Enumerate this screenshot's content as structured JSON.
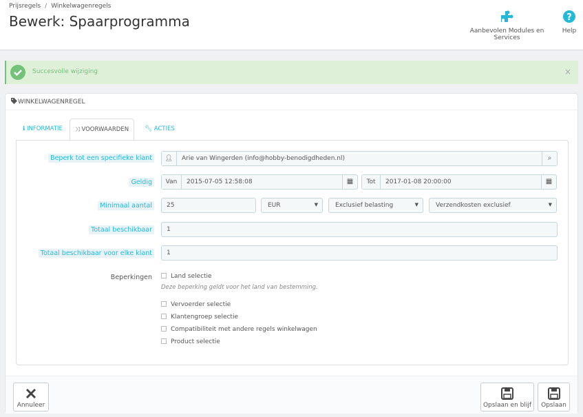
{
  "breadcrumb": {
    "item1": "Prijsregels",
    "separator": "/",
    "item2": "Winkelwagenregels"
  },
  "page_title": "Bewerk: Spaarprogramma",
  "toolbar": {
    "modules_label": "Aanbevolen Modules en Services",
    "help_label": "Help"
  },
  "alert": {
    "message": "Succesvolle wijziging",
    "close": "×"
  },
  "panel": {
    "title": "WINKELWAGENREGEL"
  },
  "tabs": [
    {
      "label": "INFORMATIE",
      "icon": "info-icon"
    },
    {
      "label": "VOORWAARDEN",
      "icon": "shuffle-icon"
    },
    {
      "label": "ACTIES",
      "icon": "wrench-icon"
    }
  ],
  "form": {
    "customer": {
      "label": "Beperk tot een specifieke klant",
      "value": "Arie van Wingerden (info@hobby-benodigdheden.nl)"
    },
    "valid": {
      "label": "Geldig",
      "from_addon": "Van",
      "from_value": "2015-07-05 12:58:08",
      "to_addon": "Tot",
      "to_value": "2017-01-08 20:00:00"
    },
    "minimum": {
      "label": "Minimaal aantal",
      "value": "25",
      "currency": "EUR",
      "tax": "Exclusief belasting",
      "shipping": "Verzendkosten exclusief"
    },
    "total": {
      "label": "Totaal beschikbaar",
      "value": "1"
    },
    "per_customer": {
      "label": "Totaal beschikbaar voor elke klant",
      "value": "1"
    },
    "restrictions": {
      "label": "Beperkingen",
      "country": "Land selectie",
      "hint": "Deze beperking geldt voor het land van bestemming.",
      "carrier": "Vervoerder selectie",
      "group": "Klantengroep selectie",
      "compat": "Compatibiliteit met andere regels winkelwagen",
      "product": "Product selectie"
    }
  },
  "footer": {
    "cancel": "Annuleer",
    "save_stay": "Opslaan en blijf",
    "save": "Opslaan"
  },
  "colors": {
    "accent": "#25b9d7",
    "success": "#72c279"
  }
}
